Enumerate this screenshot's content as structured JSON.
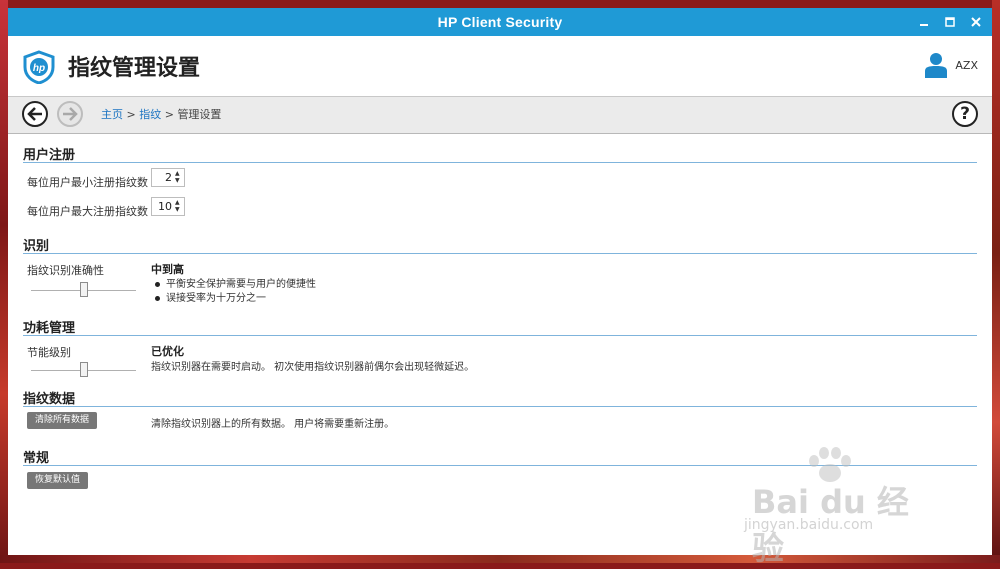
{
  "window": {
    "title": "HP Client Security"
  },
  "header": {
    "page_title": "指纹管理设置",
    "user_name": "AZX"
  },
  "nav": {
    "breadcrumb": [
      {
        "label": "主页",
        "link": true
      },
      {
        "label": "指纹",
        "link": true
      },
      {
        "label": "管理设置",
        "link": false
      }
    ],
    "separator": ">",
    "help_label": "?"
  },
  "sections": {
    "registration": {
      "title": "用户注册",
      "min_label": "每位用户最小注册指纹数",
      "min_value": "2",
      "max_label": "每位用户最大注册指纹数",
      "max_value": "10"
    },
    "recognition": {
      "title": "识别",
      "slider_label": "指纹识别准确性",
      "level": 0.5,
      "level_title": "中到高",
      "bullets": [
        "平衡安全保护需要与用户的便捷性",
        "误接受率为十万分之一"
      ]
    },
    "power": {
      "title": "功耗管理",
      "slider_label": "节能级别",
      "level": 0.5,
      "level_title": "已优化",
      "level_desc": "指纹识别器在需要时启动。 初次使用指纹识别器前偶尔会出现轻微延迟。"
    },
    "data": {
      "title": "指纹数据",
      "button": "清除所有数据",
      "desc": "清除指纹识别器上的所有数据。 用户将需要重新注册。"
    },
    "general": {
      "title": "常规",
      "button": "恢复默认值"
    }
  },
  "watermark": {
    "brand": "Bai du 经验",
    "sub": "jingyan.baidu.com"
  },
  "colors": {
    "titlebar": "#1f9ad6",
    "accent_line": "#7fb4dc",
    "link": "#1c74c2",
    "button": "#777777"
  }
}
